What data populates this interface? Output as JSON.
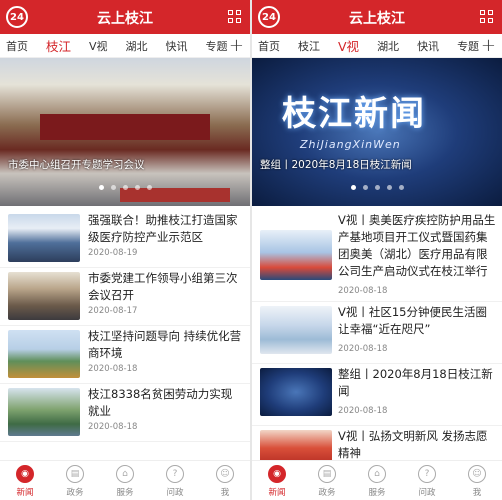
{
  "app": {
    "logo_text": "24",
    "title": "云上枝江"
  },
  "left": {
    "tabs": [
      {
        "label": "首页",
        "active": false
      },
      {
        "label": "枝江",
        "active": true
      },
      {
        "label": "V视",
        "active": false
      },
      {
        "label": "湖北",
        "active": false
      },
      {
        "label": "快讯",
        "active": false
      },
      {
        "label": "专题",
        "active": false
      }
    ],
    "hero_caption": "市委中心组召开专题学习会议",
    "news": [
      {
        "title": "强强联合！助推枝江打造国家级医疗防控产业示范区",
        "date": "2020-08-19"
      },
      {
        "title": "市委党建工作领导小组第三次会议召开",
        "date": "2020-08-17"
      },
      {
        "title": "枝江坚持问题导向 持续优化营商环境",
        "date": "2020-08-18"
      },
      {
        "title": "枝江8338名贫困劳动力实现就业",
        "date": "2020-08-18"
      }
    ]
  },
  "right": {
    "tabs": [
      {
        "label": "首页",
        "active": false
      },
      {
        "label": "枝江",
        "active": false
      },
      {
        "label": "V视",
        "active": true
      },
      {
        "label": "湖北",
        "active": false
      },
      {
        "label": "快讯",
        "active": false
      },
      {
        "label": "专题",
        "active": false
      }
    ],
    "hero_title": "枝江新闻",
    "hero_pinyin": "ZhiJiangXinWen",
    "hero_caption": "整组丨2020年8月18日枝江新闻",
    "news": [
      {
        "title": "V视丨奥美医疗疾控防护用品生产基地项目开工仪式暨国药集团奥美（湖北）医疗用品有限公司生产启动仪式在枝江举行",
        "date": ""
      },
      {
        "title": "V视丨社区15分钟便民生活圈 让幸福“近在咫尺”",
        "date": "2020-08-18"
      },
      {
        "title": "整组丨2020年8月18日枝江新闻",
        "date": "2020-08-18"
      },
      {
        "title": "V视丨弘扬文明新风 发扬志愿精神",
        "date": ""
      }
    ],
    "news_first_date": "2020-08-18"
  },
  "bottom_nav": [
    {
      "label": "新闻",
      "icon": "news-icon",
      "active": true
    },
    {
      "label": "政务",
      "icon": "gov-icon",
      "active": false
    },
    {
      "label": "服务",
      "icon": "service-icon",
      "active": false
    },
    {
      "label": "问政",
      "icon": "ask-icon",
      "active": false
    },
    {
      "label": "我",
      "icon": "user-icon",
      "active": false
    }
  ],
  "colors": {
    "brand": "#d4262a"
  }
}
